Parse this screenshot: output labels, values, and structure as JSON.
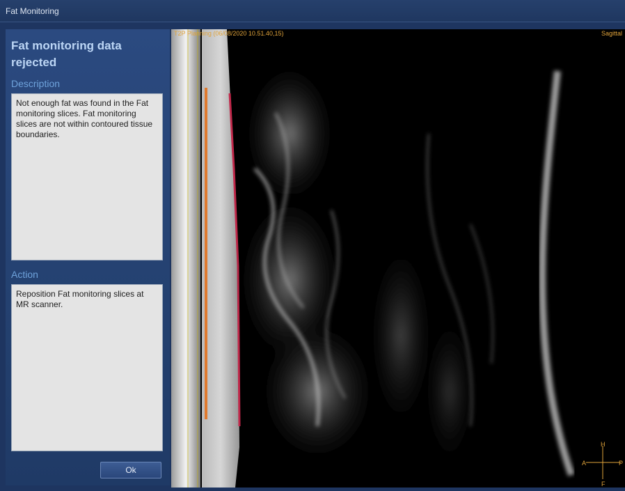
{
  "window": {
    "title": "Fat Monitoring"
  },
  "panel": {
    "heading": "Fat monitoring data rejected",
    "description_label": "Description",
    "description_text": "Not enough fat was found in the Fat monitoring slices. Fat monitoring slices are not within contoured tissue boundaries.",
    "action_label": "Action",
    "action_text": "Reposition Fat monitoring slices at MR scanner.",
    "ok_label": "Ok"
  },
  "viewer": {
    "series_label": "T2P Planning (06/08/2020 10.51.40,15)",
    "orientation_label": "Sagittal",
    "compass": {
      "top": "H",
      "bottom": "F",
      "left": "A",
      "right": "P"
    },
    "contour_colors": {
      "orange": "#e07a2e",
      "red": "#c0284a"
    }
  }
}
